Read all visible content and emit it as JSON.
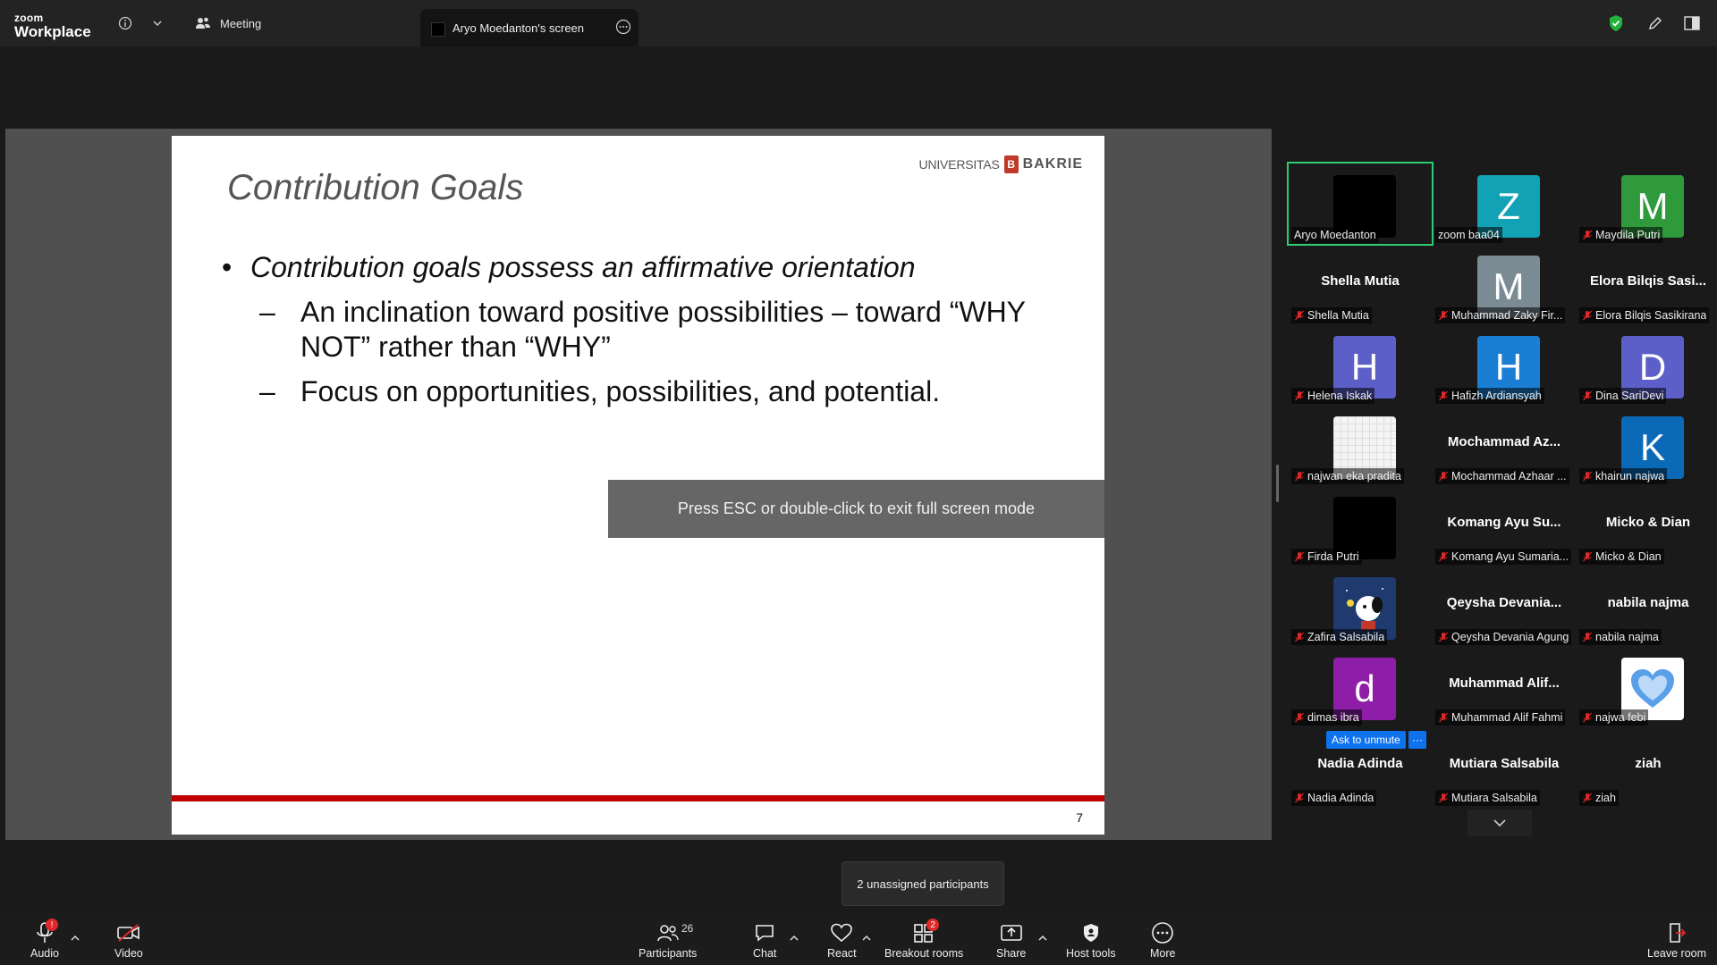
{
  "app": {
    "logo_top": "zoom",
    "logo_bottom": "Workplace"
  },
  "tabs": {
    "meeting": "Meeting",
    "screen": "Aryo Moedanton's screen"
  },
  "slide": {
    "title": "Contribution Goals",
    "university_prefix": "UNIVERSITAS",
    "university_name": "BAKRIE",
    "bullet": "Contribution goals possess an affirmative orientation",
    "sub1": "An inclination toward positive possibilities – toward “WHY NOT” rather than “WHY”",
    "sub2": "Focus on opportunities, possibilities, and  potential.",
    "page_number": "7"
  },
  "esc_banner": "Press ESC or double-click to exit full screen mode",
  "participants": [
    {
      "name": "Aryo Moedanton",
      "video": "dark",
      "muted": false,
      "active": true
    },
    {
      "name": "zoom baa04",
      "letter": "Z",
      "color": "#12a2b5",
      "muted": false
    },
    {
      "name": "Maydila Putri",
      "letter": "M",
      "color": "#2e9a3c",
      "muted": true
    },
    {
      "name": "Shella Mutia",
      "big": "Shella Mutia",
      "muted": true
    },
    {
      "name": "Muhammad Zaky Fir...",
      "letter": "M",
      "color": "#7b8b94",
      "muted": true
    },
    {
      "name": "Elora Bilqis Sasikirana",
      "big": "Elora Bilqis Sasi...",
      "muted": true
    },
    {
      "name": "Helena Iskak",
      "letter": "H",
      "color": "#5b5fc7",
      "muted": true
    },
    {
      "name": "Hafizh Ardiansyah",
      "letter": "H",
      "color": "#1a7fd4",
      "muted": true
    },
    {
      "name": "Dina SariDevi",
      "letter": "D",
      "color": "#5b5fc7",
      "muted": true
    },
    {
      "name": "najwan eka pradita",
      "video": "grid",
      "muted": true
    },
    {
      "name": "Mochammad Azhaar ...",
      "big": "Mochammad  Az...",
      "muted": true
    },
    {
      "name": "khairun najwa",
      "letter": "K",
      "color": "#0a6ab8",
      "muted": true
    },
    {
      "name": "Firda Putri",
      "video": "dark",
      "muted": true
    },
    {
      "name": "Komang Ayu Sumaria...",
      "big": "Komang Ayu Su...",
      "muted": true
    },
    {
      "name": "Micko & Dian",
      "big": "Micko & Dian",
      "muted": true
    },
    {
      "name": "Zafira Salsabila",
      "video": "snoopy",
      "muted": true
    },
    {
      "name": "Qeysha Devania Agung",
      "big": "Qeysha  Devania...",
      "muted": true
    },
    {
      "name": "nabila najma",
      "big": "nabila najma",
      "muted": true
    },
    {
      "name": "dimas ibra",
      "letter": "d",
      "color": "#8e1ea8",
      "muted": true
    },
    {
      "name": "Muhammad Alif Fahmi",
      "big": "Muhammad  Alif...",
      "muted": true
    },
    {
      "name": "najwa febi",
      "video": "heart",
      "muted": true
    },
    {
      "name": "Nadia Adinda",
      "big": "Nadia Adinda",
      "muted": true
    },
    {
      "name": "Mutiara Salsabila",
      "big": "Mutiara Salsabila",
      "muted": true
    },
    {
      "name": "ziah",
      "big": "ziah",
      "muted": true
    }
  ],
  "ask_unmute": {
    "label": "Ask to unmute",
    "more": "···"
  },
  "tooltip": "2 unassigned participants",
  "toolbar": {
    "audio": "Audio",
    "video": "Video",
    "participants": "Participants",
    "participants_count": "26",
    "chat": "Chat",
    "react": "React",
    "breakout": "Breakout rooms",
    "breakout_badge": "2",
    "share": "Share",
    "host_tools": "Host tools",
    "more": "More",
    "leave": "Leave room",
    "audio_badge": "!"
  },
  "colors": {
    "active_border": "#2ecc71",
    "accent_blue": "#0e72ed",
    "slide_bar": "#c00000",
    "muted_red": "#e02828"
  }
}
